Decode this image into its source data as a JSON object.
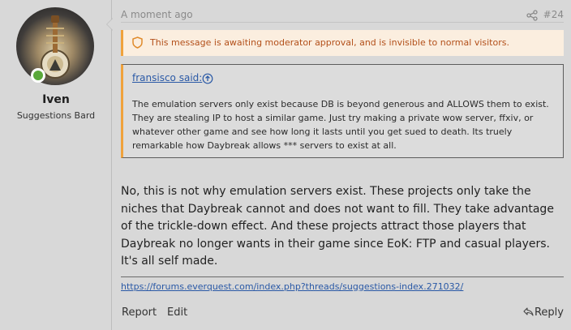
{
  "user": {
    "name": "Iven",
    "title": "Suggestions Bard"
  },
  "post": {
    "time": "A moment ago",
    "number": "#24",
    "notice": "This message is awaiting moderator approval, and is invisible to normal visitors.",
    "quote": {
      "author": "fransisco said:",
      "body": "The emulation servers only exist because DB is beyond generous and ALLOWS them to exist. They are stealing IP to host a similar game. Just try making a private wow server, ffxiv, or whatever other game and see how long it lasts until you get sued to death. Its truely remarkable how Daybreak allows *** servers to exist at all."
    },
    "message": "No, this is not why emulation servers exist. These projects only take the niches that Daybreak cannot and does not want to fill. They take advantage of the trickle-down effect. And these projects attract those players that Daybreak no longer wants in their game since EoK: FTP and casual players. It's all self made.",
    "signature_link": "https://forums.everquest.com/index.php?threads/suggestions-index.271032/"
  },
  "actions": {
    "report": "Report",
    "edit": "Edit",
    "reply": "Reply"
  },
  "icons": {
    "share": "share-icon",
    "notice": "shield-icon",
    "quote_jump": "arrow-up-circle-icon",
    "reply": "reply-arrow-icon",
    "online": "online-status-icon"
  },
  "colors": {
    "background": "#d8d8d8",
    "accent": "#f0a23c",
    "link": "#2a59a6",
    "notice_text": "#b3501a",
    "notice_bg": "#fbeedf",
    "online": "#5aa83a"
  }
}
